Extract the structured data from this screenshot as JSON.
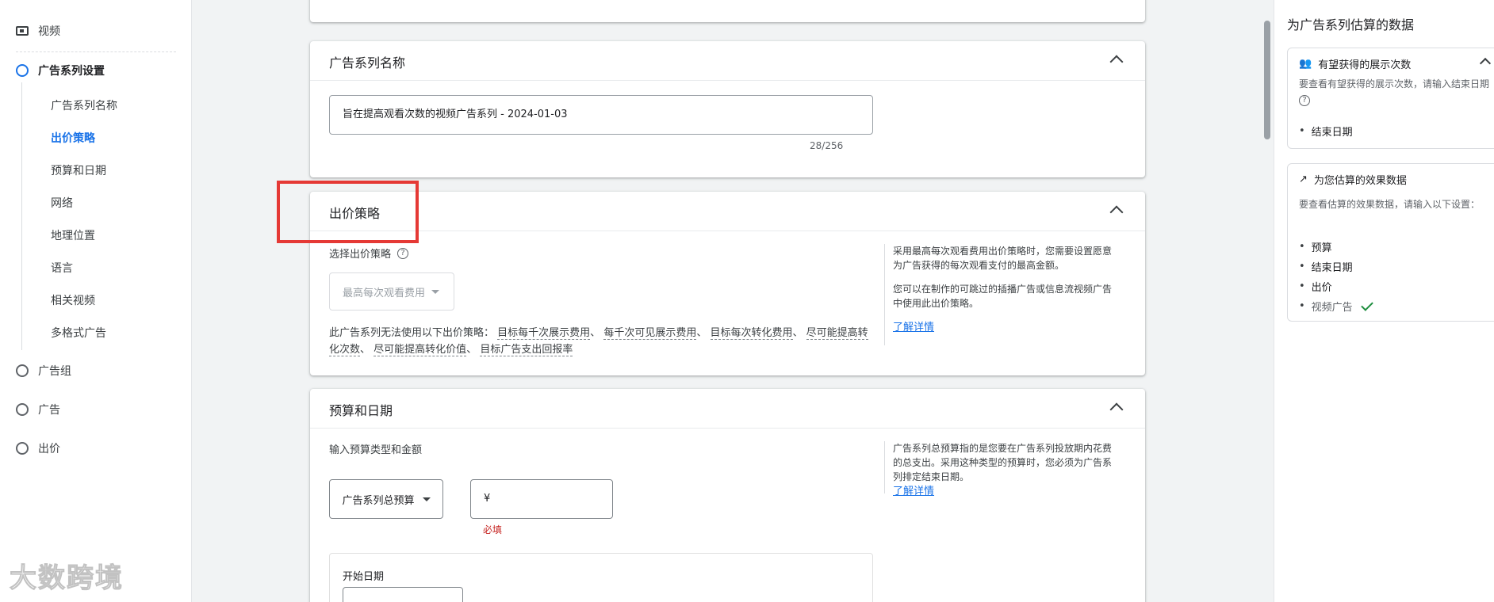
{
  "sidebar": {
    "video_label": "视频",
    "steps": [
      {
        "label": "广告系列设置",
        "active": true
      },
      {
        "label": "广告组"
      },
      {
        "label": "广告"
      },
      {
        "label": "出价"
      }
    ],
    "sub_items": [
      {
        "label": "广告系列名称"
      },
      {
        "label": "出价策略",
        "current": true
      },
      {
        "label": "预算和日期"
      },
      {
        "label": "网络"
      },
      {
        "label": "地理位置"
      },
      {
        "label": "语言"
      },
      {
        "label": "相关视频"
      },
      {
        "label": "多格式广告"
      }
    ]
  },
  "campaign_name_card": {
    "title": "广告系列名称",
    "input_value": "旨在提高观看次数的视频广告系列 - 2024-01-03",
    "counter": "28/256"
  },
  "bid_strategy_card": {
    "title": "出价策略",
    "select_label": "选择出价策略",
    "selected_strategy": "最高每次观看费用",
    "unavailable_prefix": "此广告系列无法使用以下出价策略：",
    "unavailable_strategies": [
      "目标每千次展示费用",
      "每千次可见展示费用",
      "目标每次转化费用",
      "尽可能提高转化次数",
      "尽可能提高转化价值",
      "目标广告支出回报率"
    ],
    "separator": "、",
    "side_note_1": "采用最高每次观看费用出价策略时，您需要设置愿意为广告获得的每次观看支付的最高金额。",
    "side_note_2": "您可以在制作的可跳过的插播广告或信息流视频广告中使用此出价策略。",
    "learn_more": "了解详情"
  },
  "budget_card": {
    "title": "预算和日期",
    "prompt": "输入预算类型和金额",
    "budget_type": "广告系列总预算",
    "currency_symbol": "¥",
    "required_text": "必填",
    "side_note": "广告系列总预算指的是您要在广告系列投放期内花费的总支出。采用这种类型的预算时，您必须为广告系列排定结束日期。",
    "learn_more": "了解详情",
    "start_date_label": "开始日期"
  },
  "right_panel": {
    "title": "为广告系列估算的数据",
    "impressions": {
      "title": "有望获得的展示次数",
      "body": "要查看有望获得的展示次数，请输入结束日期",
      "items": [
        "结束日期"
      ]
    },
    "performance": {
      "title": "为您估算的效果数据",
      "body": "要查看估算的效果数据，请输入以下设置：",
      "items": [
        "预算",
        "结束日期",
        "出价"
      ],
      "done_item": "视频广告"
    }
  },
  "watermark": "大数跨境",
  "colors": {
    "accent": "#1a73e8",
    "highlight": "#e53935",
    "required": "#c5221f",
    "success": "#1e8e3e"
  }
}
